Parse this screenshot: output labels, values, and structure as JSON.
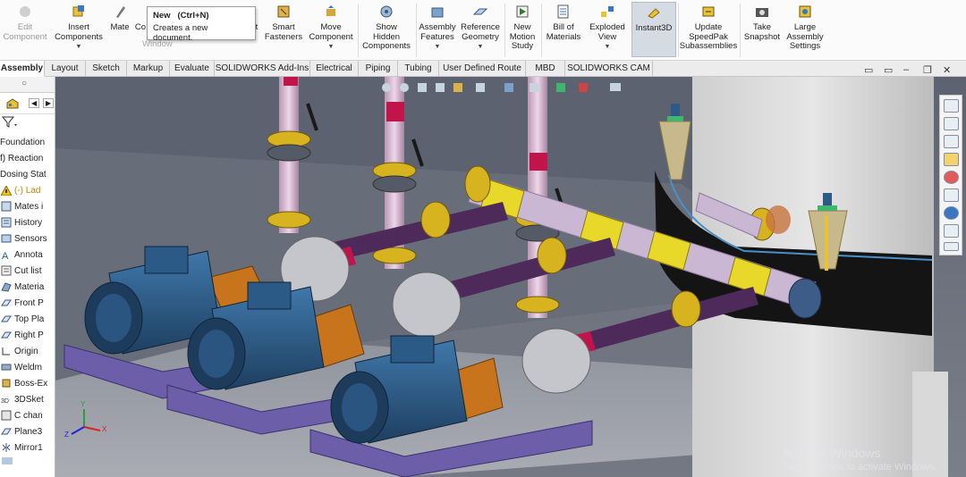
{
  "ribbon": {
    "buttons": [
      {
        "id": "edit-component",
        "label": "Edit\nComponent",
        "disabled": true
      },
      {
        "id": "insert-components",
        "label": "Insert\nComponents",
        "dropdown": true
      },
      {
        "id": "mate",
        "label": "Mate"
      },
      {
        "id": "co",
        "label": "Co"
      },
      {
        "id": "partial-t",
        "label": "t"
      },
      {
        "id": "smart-fasteners",
        "label": "Smart\nFasteners"
      },
      {
        "id": "move-component",
        "label": "Move\nComponent",
        "dropdown": true
      },
      {
        "id": "show-hidden",
        "label": "Show\nHidden\nComponents"
      },
      {
        "id": "assembly-features",
        "label": "Assembly\nFeatures",
        "dropdown": true
      },
      {
        "id": "reference-geometry",
        "label": "Reference\nGeometry",
        "dropdown": true
      },
      {
        "id": "new-motion-study",
        "label": "New\nMotion\nStudy"
      },
      {
        "id": "bill-of-materials",
        "label": "Bill of\nMaterials"
      },
      {
        "id": "exploded-view",
        "label": "Exploded\nView",
        "dropdown": true
      },
      {
        "id": "instant3d",
        "label": "Instant3D"
      },
      {
        "id": "update-speedpak",
        "label": "Update\nSpeedPak\nSubassemblies"
      },
      {
        "id": "take-snapshot",
        "label": "Take\nSnapshot"
      },
      {
        "id": "large-assembly",
        "label": "Large\nAssembly\nSettings"
      }
    ]
  },
  "tooltip": {
    "title": "New   (Ctrl+N)",
    "description": "Creates a new document.",
    "ghost_text": "Window"
  },
  "tabs": [
    "Assembly",
    "Layout",
    "Sketch",
    "Markup",
    "Evaluate",
    "SOLIDWORKS Add-Ins",
    "Electrical",
    "Piping",
    "Tubing",
    "User Defined Route",
    "MBD",
    "SOLIDWORKS CAM"
  ],
  "active_tab": "Assembly",
  "feature_tree": {
    "items": [
      {
        "label": "Foundation",
        "icon": "none"
      },
      {
        "label": "f) Reaction",
        "icon": "none"
      },
      {
        "label": "Dosing Stat",
        "icon": "none"
      },
      {
        "label": "(-) Lad",
        "icon": "warning-icon",
        "color": "#b58a00"
      },
      {
        "label": "Mates i",
        "icon": "mates-icon"
      },
      {
        "label": "History",
        "icon": "history-icon"
      },
      {
        "label": "Sensors",
        "icon": "sensor-icon"
      },
      {
        "label": "Annota",
        "icon": "annotation-icon"
      },
      {
        "label": "Cut list",
        "icon": "cutlist-icon"
      },
      {
        "label": "Materia",
        "icon": "material-icon"
      },
      {
        "label": "Front P",
        "icon": "plane-icon"
      },
      {
        "label": "Top Pla",
        "icon": "plane-icon"
      },
      {
        "label": "Right P",
        "icon": "plane-icon"
      },
      {
        "label": "Origin",
        "icon": "origin-icon"
      },
      {
        "label": "Weldm",
        "icon": "weldment-icon"
      },
      {
        "label": "Boss-Ex",
        "icon": "boss-icon"
      },
      {
        "label": "3DSket",
        "icon": "sketch3d-icon"
      },
      {
        "label": "C chan",
        "icon": "channel-icon"
      },
      {
        "label": "Plane3",
        "icon": "plane-icon"
      },
      {
        "label": "Mirror1",
        "icon": "mirror-icon"
      }
    ]
  },
  "triad": {
    "x": "X",
    "y": "Y",
    "z": "Z"
  },
  "watermark": {
    "line1": "Activate Windows",
    "line2": "Go to Settings to activate Windows."
  },
  "colors": {
    "viewport_bg": "#656a76",
    "motor": "#2d5a86",
    "skid": "#6c5ea8",
    "coupling_guard": "#c8741d",
    "pipe": "#4d2a5a",
    "pipe_light": "#e7cbe3",
    "flange": "#d8b320",
    "header": "#c9b7d4",
    "accent_red": "#c0144a",
    "tank": "#d8d8d8"
  }
}
